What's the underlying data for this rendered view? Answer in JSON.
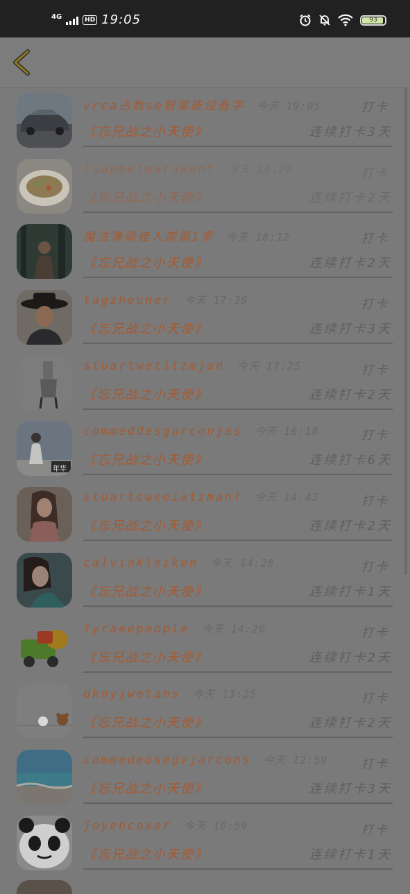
{
  "status_bar": {
    "network": "4G",
    "hd": "HD",
    "time": "19:05",
    "battery": "93"
  },
  "header": {
    "back_icon": "chevron-left-icon"
  },
  "items": [
    {
      "name": "vrca占数se智桨能设备字",
      "time": "今天 19:05",
      "punch": "打卡",
      "book": "《忘兄战之小天使》",
      "streak": "连续打卡3天",
      "avatar": "car",
      "faded": false
    },
    {
      "name": "lsapbelmaraaent",
      "time": "今天 18:20",
      "punch": "打卡",
      "book": "《忘兄战之小天使》",
      "streak": "连续打卡2天",
      "avatar": "food",
      "faded": true
    },
    {
      "name": "魔法簿倘佳人崇第1季",
      "time": "今天 18:12",
      "punch": "打卡",
      "book": "《忘兄战之小天使》",
      "streak": "连续打卡2天",
      "avatar": "forest-person",
      "faded": false
    },
    {
      "name": "tagzheuner",
      "time": "今天 17:39",
      "punch": "打卡",
      "book": "《忘兄战之小天使》",
      "streak": "连续打卡3天",
      "avatar": "man-hat",
      "faded": false
    },
    {
      "name": "stuartwetitzmjan",
      "time": "今天 17:25",
      "punch": "打卡",
      "book": "《忘兄战之小天使》",
      "streak": "连续打卡2天",
      "avatar": "chair-sketch",
      "faded": false
    },
    {
      "name": "commeddesgarconjas",
      "time": "今天 16:18",
      "punch": "打卡",
      "book": "《忘兄战之小天使》",
      "streak": "连续打卡6天",
      "avatar": "person-sky",
      "faded": false
    },
    {
      "name": "stuartcweeiatzmanf",
      "time": "今天 14:43",
      "punch": "打卡",
      "book": "《忘兄战之小天使》",
      "streak": "连续打卡2天",
      "avatar": "woman-hair",
      "faded": false
    },
    {
      "name": "calvinkleiken",
      "time": "今天 14:28",
      "punch": "打卡",
      "book": "《忘兄战之小天使》",
      "streak": "连续打卡1天",
      "avatar": "woman-portrait",
      "faded": false
    },
    {
      "name": "fyraeepeople",
      "time": "今天 14:20",
      "punch": "打卡",
      "book": "《忘兄战之小天使》",
      "streak": "连续打卡2天",
      "avatar": "toy-truck",
      "faded": false
    },
    {
      "name": "dknyjwetans",
      "time": "今天 13:25",
      "punch": "打卡",
      "book": "《忘兄战之小天使》",
      "streak": "连续打卡2天",
      "avatar": "bears",
      "faded": false
    },
    {
      "name": "commedeosegvjarcons",
      "time": "今天 12:59",
      "punch": "打卡",
      "book": "《忘兄战之小天使》",
      "streak": "连续打卡3天",
      "avatar": "sea",
      "faded": false
    },
    {
      "name": "joyebcoxer",
      "time": "今天 10:59",
      "punch": "打卡",
      "book": "《忘兄战之小天使》",
      "streak": "连续打卡1天",
      "avatar": "panda",
      "faded": false
    }
  ],
  "avatar_labels": {
    "person_sky_caption": "年华"
  },
  "colors": {
    "accent": "#a35a33",
    "muted": "#5f5f5f",
    "background": "#7a7a7a",
    "status_bar": "#212121"
  }
}
